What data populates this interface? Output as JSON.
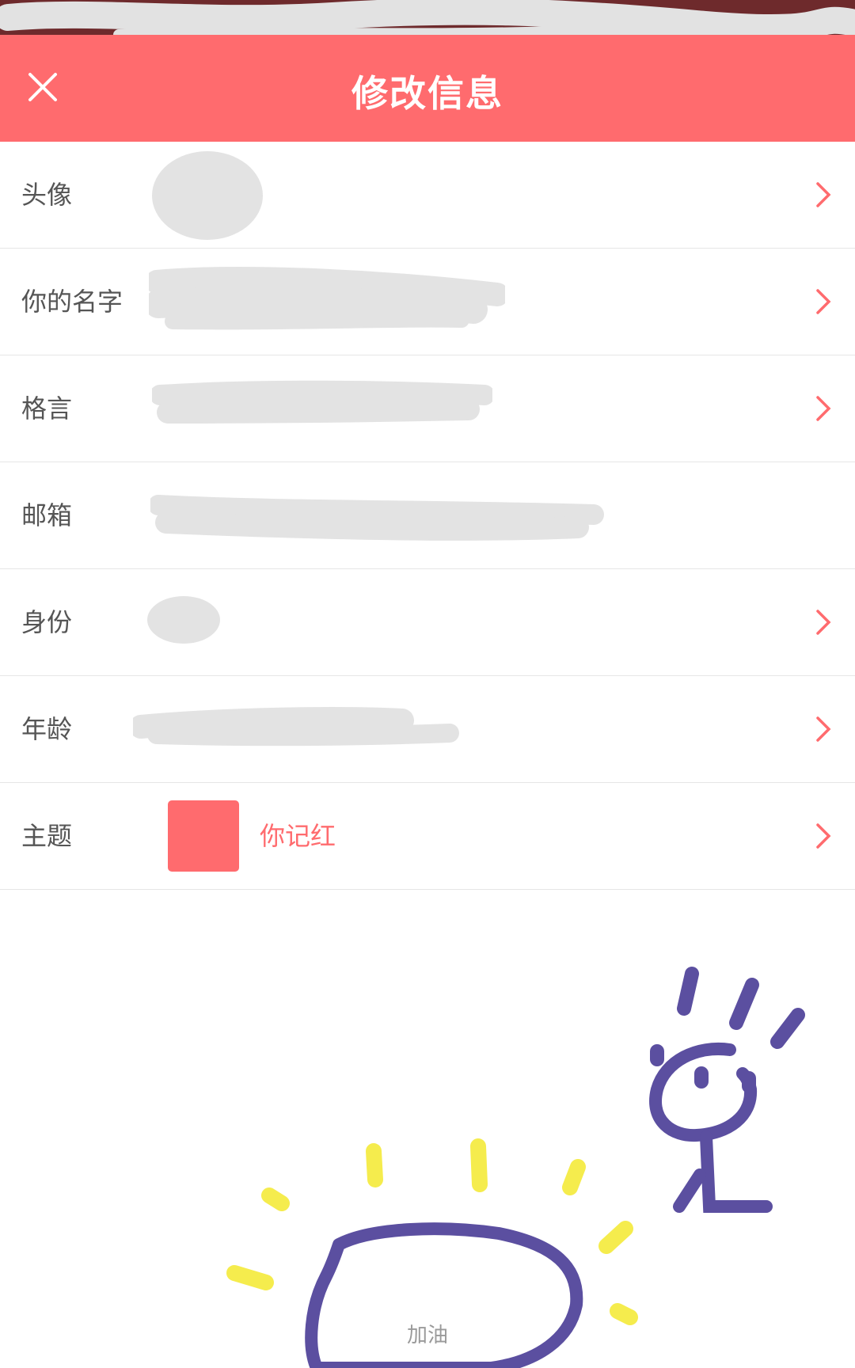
{
  "header": {
    "title": "修改信息"
  },
  "rows": [
    {
      "label": "头像",
      "has_arrow": true
    },
    {
      "label": "你的名字",
      "has_arrow": true
    },
    {
      "label": "格言",
      "has_arrow": true
    },
    {
      "label": "邮箱",
      "has_arrow": false
    },
    {
      "label": "身份",
      "has_arrow": true
    },
    {
      "label": "年龄",
      "has_arrow": true
    },
    {
      "label": "主题",
      "has_arrow": true
    }
  ],
  "theme": {
    "name": "你记红",
    "color": "#ff6b6e"
  },
  "doodle": {
    "caption": "加油"
  },
  "colors": {
    "accent": "#ff6b6e",
    "doodle_purple": "#5b4fa0",
    "doodle_yellow": "#f5ec4d"
  }
}
